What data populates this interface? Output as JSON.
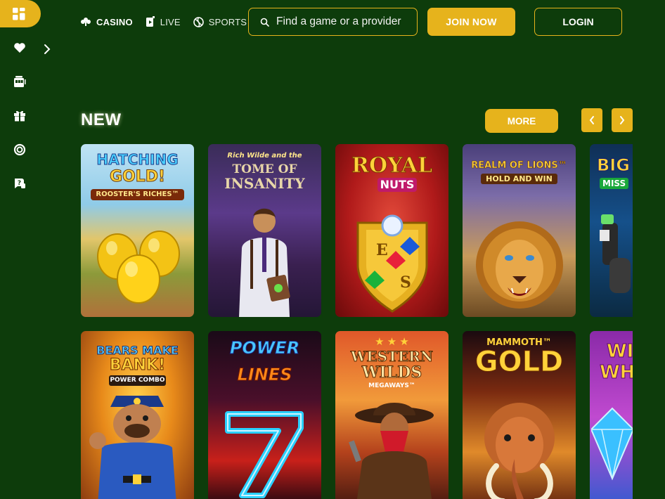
{
  "nav": {
    "casino": "CASINO",
    "live": "LIVE",
    "sports": "SPORTS"
  },
  "search": {
    "placeholder": "Find a game or a provider"
  },
  "buttons": {
    "join": "JOIN NOW",
    "login": "LOGIN",
    "more": "MORE"
  },
  "section": {
    "title": "NEW"
  },
  "sidebar": {
    "icons": [
      "grid-icon",
      "heart-icon",
      "slot-machine-icon",
      "gift-icon",
      "life-ring-icon",
      "help-chat-icon"
    ]
  },
  "games": {
    "row1": [
      {
        "t1": "HATCHING",
        "t2": "GOLD!",
        "t3": "ROOSTER'S RICHES™"
      },
      {
        "t1": "Rich Wilde and the",
        "t2": "TOME OF",
        "t3": "INSANITY"
      },
      {
        "t1": "ROYAL",
        "t2": "NUTS"
      },
      {
        "t1": "REALM OF LIONS™",
        "t2": "HOLD AND WIN"
      },
      {
        "t1": "BIG",
        "t2": "MISS"
      }
    ],
    "row2": [
      {
        "t1": "BEARS MAKE",
        "t2": "BANK!",
        "t3": "POWER COMBO"
      },
      {
        "t1": "POWER",
        "t2": "LINES"
      },
      {
        "t1": "WESTERN",
        "t2": "WILDS",
        "t3": "MEGAWAYS™"
      },
      {
        "t1": "MAMMOTH™",
        "t2": "GOLD"
      },
      {
        "t1": "WI",
        "t2": "WHI"
      }
    ]
  },
  "colors": {
    "background": "#0d3c0b",
    "accent": "#e6b31c"
  }
}
